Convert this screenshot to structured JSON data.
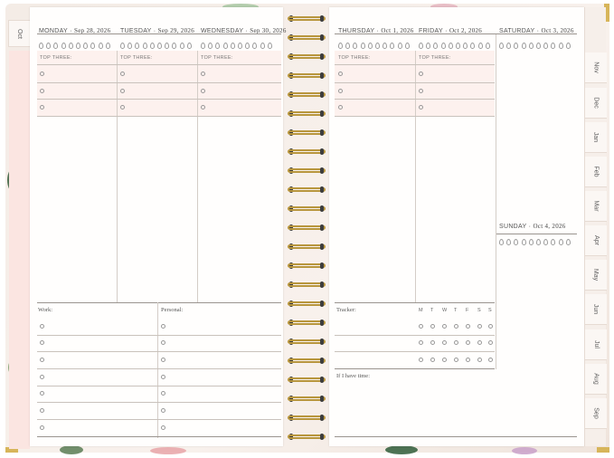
{
  "left_tab": "Oct",
  "month_tabs": [
    "Nov",
    "Dec",
    "Jan",
    "Feb",
    "Mar",
    "Apr",
    "May",
    "Jun",
    "Jul",
    "Aug",
    "Sep"
  ],
  "left_page": {
    "days": [
      {
        "weekday": "MONDAY",
        "date": "Sep 28, 2026"
      },
      {
        "weekday": "TUESDAY",
        "date": "Sep 29, 2026"
      },
      {
        "weekday": "WEDNESDAY",
        "date": "Sep 30, 2026"
      }
    ],
    "top_three_label": "TOP THREE:",
    "work_label": "Work:",
    "personal_label": "Personal:"
  },
  "right_page": {
    "days": [
      {
        "weekday": "THURSDAY",
        "date": "Oct 1, 2026"
      },
      {
        "weekday": "FRIDAY",
        "date": "Oct 2, 2026"
      },
      {
        "weekday": "SATURDAY",
        "date": "Oct 3, 2026"
      }
    ],
    "sunday": {
      "weekday": "SUNDAY",
      "date": "Oct 4, 2026"
    },
    "top_three_label": "TOP THREE:",
    "tracker_label": "Tracker:",
    "tracker_days": [
      "M",
      "T",
      "W",
      "T",
      "F",
      "S",
      "S"
    ],
    "if_time_label": "If I have time:"
  },
  "colors": {
    "accent_pink": "#fdf1ee",
    "gold": "#d7b55a",
    "cover": "#f4ece6"
  }
}
